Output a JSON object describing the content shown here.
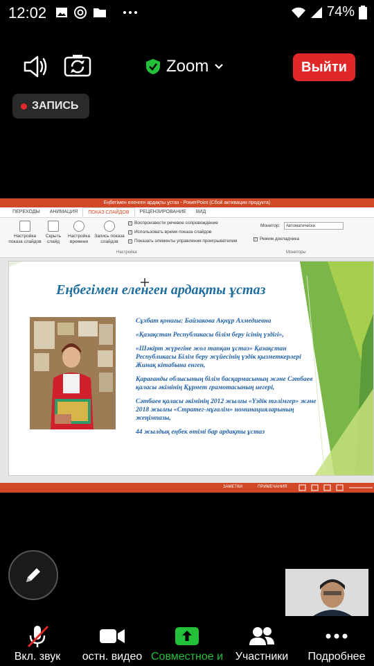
{
  "status_bar": {
    "time": "12:02",
    "battery": "74%",
    "icons": [
      "image-icon",
      "at-icon",
      "folder-icon",
      "more-icon",
      "wifi-icon",
      "signal-icon",
      "battery-icon"
    ]
  },
  "meeting_header": {
    "title": "Zoom",
    "leave_label": "Выйти",
    "colors": {
      "leave": "#e02828",
      "shield": "#23c03a"
    }
  },
  "recording": {
    "label": "ЗАПИСЬ"
  },
  "shared_screen": {
    "window_title": "Еңбегімен еленген ардақты ұстаз  -  PowerPoint (Сбой активации продукта)",
    "tabs": [
      "ПЕРЕХОДЫ",
      "АНИМАЦИЯ",
      "ПОКАЗ СЛАЙДОВ",
      "РЕЦЕНЗИРОВАНИЕ",
      "ВИД"
    ],
    "active_tab": "ПОКАЗ СЛАЙДОВ",
    "ribbon": {
      "setup_show": "Настройка показа слайдов",
      "hide_slide": "Скрыть слайд",
      "rehearse": "Настройка времени",
      "record": "Запись показа слайдов",
      "check_narration": "Воспроизвести речевое сопровождение",
      "check_timings": "Использовать время показа слайдов",
      "check_controls": "Показать элементы управления проигрывателем",
      "group_setup": "Настройка",
      "monitor_label": "Монитор:",
      "monitor_value": "Автоматически",
      "presenter_view": "Режим докладчика",
      "group_monitors": "Мониторы"
    },
    "slide": {
      "title": "Еңбегімен еленген ардақты ұстаз",
      "lines": [
        "Сұхбат қонағы: Байзакова Ақнұр Ахмедиевна",
        "«Қазақстан Республикасы білім беру ісінің үздігі»,",
        "«Шәкірт жүрегіне жол тапқан ұстаз» Қазақстан Республикасы Білім беру жүйесінің үздік қызметкерлері Жинақ кітабына енген,",
        "Қарағанды облысының білім басқармасының және Сәтбаев қаласы әкімінің Құрмет грамотасының иегері,",
        "Сәтбаев қаласы әкімінің 2012 жылғы «Үздік тәлімгер» және 2018 жылғы «Стратег-мұғалім» номинацияларының жеңімпазы,",
        "44 жылдық еңбек өтімі бар ардақты ұстаз"
      ]
    },
    "status": {
      "notes": "ЗАМЕТКИ",
      "comments": "ПРИМЕЧАНИЯ"
    }
  },
  "toolbar": {
    "items": [
      {
        "label": "Вкл. звук",
        "icon": "mic-muted-icon"
      },
      {
        "label": "остн. видео",
        "icon": "video-icon"
      },
      {
        "label": "Совместное и",
        "icon": "share-screen-icon"
      },
      {
        "label": "Участники",
        "icon": "participants-icon"
      },
      {
        "label": "Подробнее",
        "icon": "more-icon"
      }
    ]
  }
}
